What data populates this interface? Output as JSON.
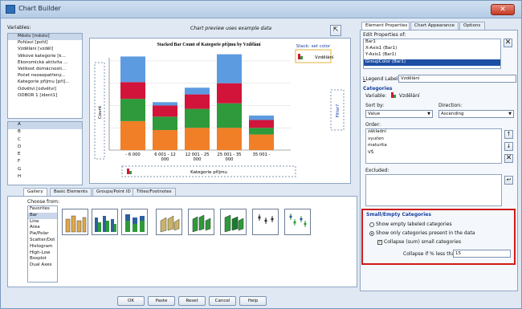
{
  "window": {
    "title": "Chart Builder",
    "close_label": "✕"
  },
  "variables": {
    "label": "Variables:",
    "items": [
      "Město [město]",
      "Pohlaví [pohl]",
      "Vzdělání [vzděl]",
      "Věkové kategorie [k...",
      "Ekonomická aktivita ...",
      "Velikost domácnosti...",
      "Počet nezaopatřený...",
      "Kategorie příjmu [pří]...",
      "Odvětví [odvětví]",
      "ODBOR 1 [ident1]"
    ],
    "categories": [
      "A",
      "B",
      "C",
      "D",
      "E",
      "F",
      "G",
      "H"
    ]
  },
  "preview": {
    "header": "Chart preview uses example data",
    "chart_title": "Stacked Bar Count of Kategorie příjmu by Vzdělání",
    "stack_label": "Stack: set color",
    "legend_item": "Vzdělání",
    "ylabel": "Count",
    "filter_label": "Filter?",
    "xlabel": "Kategorie příjmu"
  },
  "chart_data": {
    "type": "bar",
    "categories": [
      "- 6 000",
      "6 001 - 12 000",
      "12 001 - 25 000",
      "25 001 - 35 000",
      "35 001 -"
    ],
    "series": [
      {
        "name": "",
        "values": [
          2.6,
          1.8,
          2.0,
          2.0,
          1.4
        ],
        "color": "#f07f27"
      },
      {
        "name": "",
        "values": [
          2.0,
          1.2,
          1.7,
          2.2,
          0.6
        ],
        "color": "#2e9a3b"
      },
      {
        "name": "",
        "values": [
          1.5,
          1.0,
          1.3,
          1.8,
          0.7
        ],
        "color": "#d2143a"
      },
      {
        "name": "",
        "values": [
          2.3,
          0.3,
          0.6,
          2.6,
          0.4
        ],
        "color": "#5d9be0"
      }
    ]
  },
  "tabs": [
    "Gallery",
    "Basic Elements",
    "Groups/Point ID",
    "Titles/Footnotes"
  ],
  "gallery": {
    "choose_label": "Choose from:",
    "types": [
      "Favorites",
      "Bar",
      "Line",
      "Area",
      "Pie/Polar",
      "Scatter/Dot",
      "Histogram",
      "High-Low",
      "Boxplot",
      "Dual Axes"
    ],
    "selected": "Bar"
  },
  "buttons": [
    "OK",
    "Paste",
    "Reset",
    "Cancel",
    "Help"
  ],
  "right_tabs": [
    "Element Properties",
    "Chart Appearance",
    "Options"
  ],
  "props": {
    "edit_label": "Edit Properties of:",
    "items": [
      "Bar1",
      "X-Axis1 (Bar1)",
      "Y-Axis1 (Bar1)",
      "GroupColor (Bar1)"
    ],
    "selected": "GroupColor (Bar1)",
    "legend_label": "Legend Label:",
    "legend_value": "Vzdělání"
  },
  "categories": {
    "title": "Categories",
    "variable_label": "Variable:",
    "variable_value": "Vzdělání",
    "sortby_label": "Sort by:",
    "sortby_value": "Value",
    "direction_label": "Direction:",
    "direction_value": "Ascending",
    "order_label": "Order:",
    "order_items": [
      "základní",
      "vyučen",
      "maturita",
      "VŠ"
    ],
    "excluded_label": "Excluded:"
  },
  "small": {
    "title": "Small/Empty Categories",
    "opt1": "Show empty labeled categories",
    "opt2": "Show only categories present in the data",
    "collapse": "Collapse (sum) small categories",
    "pct_label": "Collapse if % less than:",
    "pct_value": "15"
  }
}
